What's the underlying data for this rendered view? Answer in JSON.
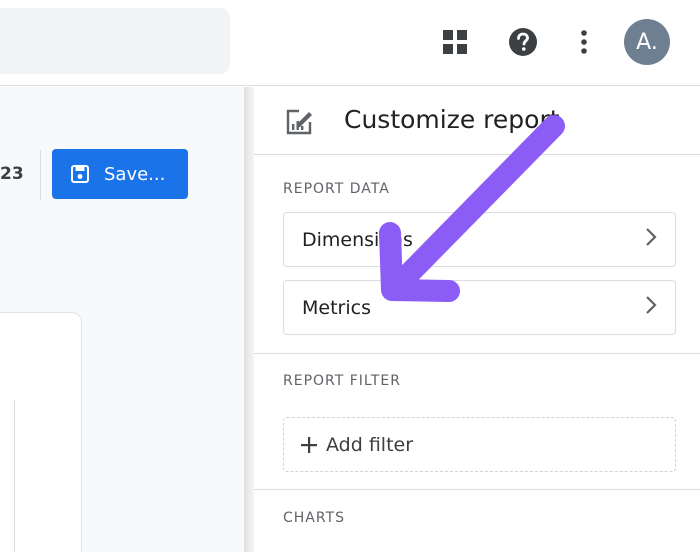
{
  "header": {
    "avatar_initial": "A.",
    "icons": [
      "apps-grid-icon",
      "help-icon",
      "more-vert-icon"
    ]
  },
  "toolbar": {
    "date_fragment": "23",
    "save_label": "Save..."
  },
  "panel": {
    "title": "Customize report",
    "sections": {
      "report_data": {
        "label": "REPORT DATA",
        "items": [
          {
            "label": "Dimensions"
          },
          {
            "label": "Metrics"
          }
        ]
      },
      "report_filter": {
        "label": "REPORT FILTER",
        "add_filter_label": "Add filter"
      },
      "charts": {
        "label": "CHARTS"
      }
    }
  },
  "colors": {
    "accent_blue": "#1a73e8",
    "annotation_purple": "#8b5cf6",
    "avatar_bg": "#6e7f91"
  }
}
